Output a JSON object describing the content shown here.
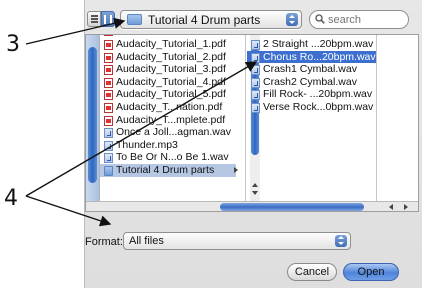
{
  "callouts": {
    "three": "3",
    "four": "4"
  },
  "toolbar": {
    "location": "Tutorial 4 Drum parts",
    "search_placeholder": "search"
  },
  "column1": {
    "items": [
      {
        "label": "Audacity_Tutorial_1.pdf",
        "icon": "pdf-icon"
      },
      {
        "label": "Audacity_Tutorial_2.pdf",
        "icon": "pdf-icon"
      },
      {
        "label": "Audacity_Tutorial_3.pdf",
        "icon": "pdf-icon"
      },
      {
        "label": "Audacity_Tutorial_4.pdf",
        "icon": "pdf-icon"
      },
      {
        "label": "Audacity_Tutorial_5.pdf",
        "icon": "pdf-icon"
      },
      {
        "label": "Audacity_T...nation.pdf",
        "icon": "pdf-icon"
      },
      {
        "label": "Audacity_T...mplete.pdf",
        "icon": "pdf-icon"
      },
      {
        "label": "Once a Joll...agman.wav",
        "icon": "audio-icon"
      },
      {
        "label": "Thunder.mp3",
        "icon": "audio-icon"
      },
      {
        "label": "To Be Or N...o Be 1.wav",
        "icon": "audio-icon"
      },
      {
        "label": "Tutorial 4 Drum parts",
        "icon": "folder-icon"
      }
    ]
  },
  "column2": {
    "items": [
      {
        "label": "2 Straight ...20bpm.wav",
        "icon": "audio-icon"
      },
      {
        "label": "Chorus Ro...20bpm.wav",
        "icon": "audio-icon"
      },
      {
        "label": "Crash1 Cymbal.wav",
        "icon": "audio-icon"
      },
      {
        "label": "Crash2 Cymbal.wav",
        "icon": "audio-icon"
      },
      {
        "label": "Fill Rock- ...20bpm.wav",
        "icon": "audio-icon"
      },
      {
        "label": "Verse Rock...0bpm.wav",
        "icon": "audio-icon"
      }
    ]
  },
  "format": {
    "label": "Format:",
    "value": "All files"
  },
  "buttons": {
    "cancel": "Cancel",
    "open": "Open"
  },
  "colors": {
    "selection_active": "#3d6fd1",
    "selection_inactive": "#b5c7e3",
    "scroll_thumb": "#3a6cc4"
  }
}
